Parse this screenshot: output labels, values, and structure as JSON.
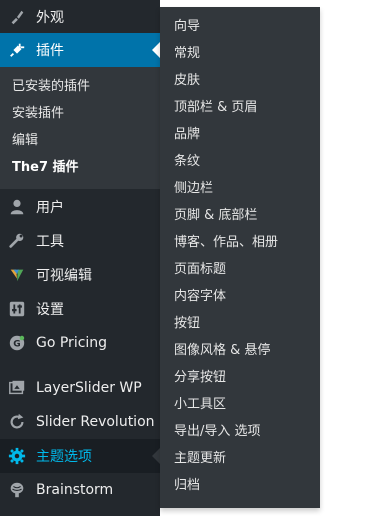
{
  "sidebar": {
    "items": [
      {
        "label": "外观",
        "icon": "paintbrush-icon"
      },
      {
        "label": "插件",
        "icon": "plugin-icon"
      },
      {
        "label": "用户",
        "icon": "user-icon"
      },
      {
        "label": "工具",
        "icon": "wrench-icon"
      },
      {
        "label": "可视编辑",
        "icon": "visual-composer-icon"
      },
      {
        "label": "设置",
        "icon": "settings-sliders-icon"
      },
      {
        "label": "Go Pricing",
        "icon": "go-pricing-icon"
      },
      {
        "label": "LayerSlider WP",
        "icon": "layerslider-icon"
      },
      {
        "label": "Slider Revolution",
        "icon": "refresh-icon"
      },
      {
        "label": "主题选项",
        "icon": "gear-icon"
      },
      {
        "label": "Brainstorm",
        "icon": "brain-icon"
      }
    ],
    "plugin_submenu": [
      "已安装的插件",
      "安装插件",
      "编辑",
      "The7 插件"
    ]
  },
  "flyout": {
    "items": [
      "向导",
      "常规",
      "皮肤",
      "顶部栏 & 页眉",
      "品牌",
      "条纹",
      "侧边栏",
      "页脚 & 底部栏",
      "博客、作品、相册",
      "页面标题",
      "内容字体",
      "按钮",
      "图像风格 & 悬停",
      "分享按钮",
      "小工具区",
      "导出/导入 选项",
      "主题更新",
      "归档"
    ]
  },
  "colors": {
    "sidebar_bg": "#23282d",
    "submenu_bg": "#32373c",
    "active_bg": "#0073aa",
    "hover_text": "#00b9eb"
  }
}
